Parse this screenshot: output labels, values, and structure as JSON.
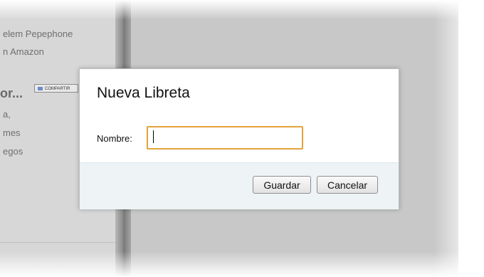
{
  "background": {
    "items": [
      "elem Pepephone",
      "n Amazon"
    ],
    "section_heading": "or...",
    "share_button_label": "COMPARTIR",
    "list_items": [
      "a,",
      "mes",
      "egos"
    ]
  },
  "dialog": {
    "title": "Nueva Libreta",
    "name_label": "Nombre:",
    "name_value": "",
    "save_label": "Guardar",
    "cancel_label": "Cancelar"
  },
  "colors": {
    "input_focus_border": "#e3a33b",
    "footer_background": "#eef3f6",
    "overlay_grey": "#c8c8c8"
  }
}
